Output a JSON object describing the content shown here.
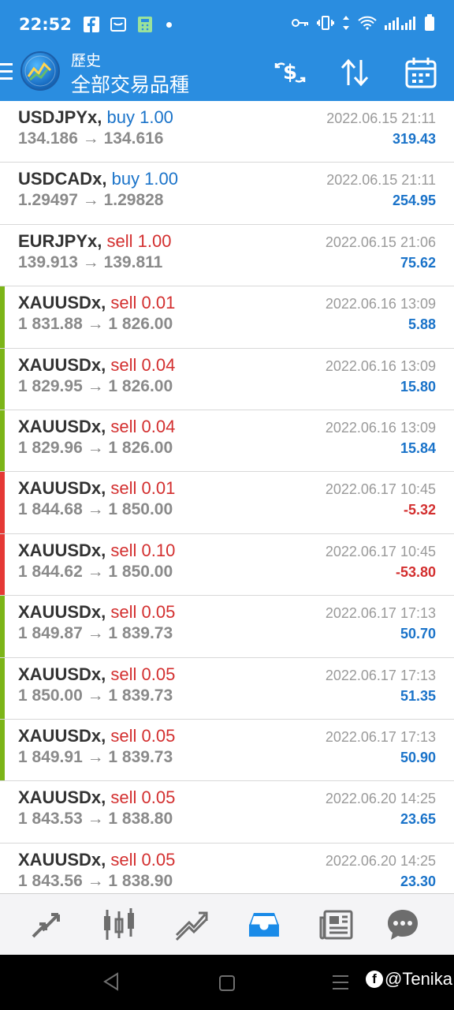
{
  "status_bar": {
    "time": "22:52"
  },
  "app_bar": {
    "subtitle": "歷史",
    "title": "全部交易品種"
  },
  "colors": {
    "primary": "#2a8de0",
    "buy": "#1a73c9",
    "sell": "#d32f2f",
    "profit_pos": "#1a73c9",
    "profit_neg": "#d32f2f",
    "bar_green": "#7cb518",
    "bar_red": "#e53935"
  },
  "rows": [
    {
      "symbol": "USDJPYx,",
      "side": "buy 1.00",
      "side_type": "buy",
      "prices": "134.186 → 134.616",
      "datetime": "2022.06.15 21:11",
      "profit": "319.43",
      "bar": "none"
    },
    {
      "symbol": "USDCADx,",
      "side": "buy 1.00",
      "side_type": "buy",
      "prices": "1.29497 → 1.29828",
      "datetime": "2022.06.15 21:11",
      "profit": "254.95",
      "bar": "none"
    },
    {
      "symbol": "EURJPYx,",
      "side": "sell 1.00",
      "side_type": "sell",
      "prices": "139.913 → 139.811",
      "datetime": "2022.06.15 21:06",
      "profit": "75.62",
      "bar": "none"
    },
    {
      "symbol": "XAUUSDx,",
      "side": "sell 0.01",
      "side_type": "sell",
      "prices": "1 831.88 → 1 826.00",
      "datetime": "2022.06.16 13:09",
      "profit": "5.88",
      "bar": "green"
    },
    {
      "symbol": "XAUUSDx,",
      "side": "sell 0.04",
      "side_type": "sell",
      "prices": "1 829.95 → 1 826.00",
      "datetime": "2022.06.16 13:09",
      "profit": "15.80",
      "bar": "green"
    },
    {
      "symbol": "XAUUSDx,",
      "side": "sell 0.04",
      "side_type": "sell",
      "prices": "1 829.96 → 1 826.00",
      "datetime": "2022.06.16 13:09",
      "profit": "15.84",
      "bar": "green"
    },
    {
      "symbol": "XAUUSDx,",
      "side": "sell 0.01",
      "side_type": "sell",
      "prices": "1 844.68 → 1 850.00",
      "datetime": "2022.06.17 10:45",
      "profit": "-5.32",
      "bar": "red"
    },
    {
      "symbol": "XAUUSDx,",
      "side": "sell 0.10",
      "side_type": "sell",
      "prices": "1 844.62 → 1 850.00",
      "datetime": "2022.06.17 10:45",
      "profit": "-53.80",
      "bar": "red"
    },
    {
      "symbol": "XAUUSDx,",
      "side": "sell 0.05",
      "side_type": "sell",
      "prices": "1 849.87 → 1 839.73",
      "datetime": "2022.06.17 17:13",
      "profit": "50.70",
      "bar": "green"
    },
    {
      "symbol": "XAUUSDx,",
      "side": "sell 0.05",
      "side_type": "sell",
      "prices": "1 850.00 → 1 839.73",
      "datetime": "2022.06.17 17:13",
      "profit": "51.35",
      "bar": "green"
    },
    {
      "symbol": "XAUUSDx,",
      "side": "sell 0.05",
      "side_type": "sell",
      "prices": "1 849.91 → 1 839.73",
      "datetime": "2022.06.17 17:13",
      "profit": "50.90",
      "bar": "green"
    },
    {
      "symbol": "XAUUSDx,",
      "side": "sell 0.05",
      "side_type": "sell",
      "prices": "1 843.53 → 1 838.80",
      "datetime": "2022.06.20 14:25",
      "profit": "23.65",
      "bar": "none"
    },
    {
      "symbol": "XAUUSDx,",
      "side": "sell 0.05",
      "side_type": "sell",
      "prices": "1 843.56 → 1 838.90",
      "datetime": "2022.06.20 14:25",
      "profit": "23.30",
      "bar": "none"
    }
  ],
  "bottom_nav": [
    {
      "icon": "quotes-arrows-icon",
      "active": false
    },
    {
      "icon": "candlestick-chart-icon",
      "active": false
    },
    {
      "icon": "trade-trend-icon",
      "active": false
    },
    {
      "icon": "history-inbox-icon",
      "active": true
    },
    {
      "icon": "news-icon",
      "active": false
    },
    {
      "icon": "chat-icon",
      "active": false
    }
  ],
  "watermark": {
    "text": "@Tenika"
  }
}
